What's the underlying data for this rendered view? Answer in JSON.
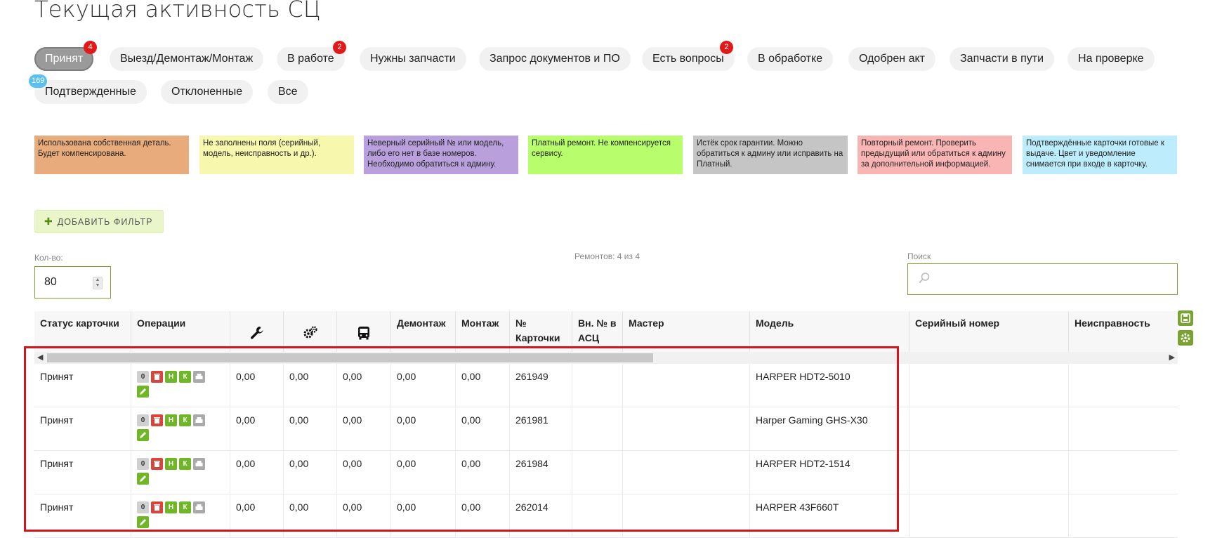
{
  "page_title": "Текущая активность СЦ",
  "tabs": [
    {
      "label": "Принят",
      "badge": "4",
      "active": true
    },
    {
      "label": "Выезд/Демонтаж/Монтаж"
    },
    {
      "label": "В работе",
      "badge": "2"
    },
    {
      "label": "Нужны запчасти"
    },
    {
      "label": "Запрос документов и ПО"
    },
    {
      "label": "Есть вопросы",
      "badge": "2"
    },
    {
      "label": "В обработке"
    },
    {
      "label": "Одобрен акт"
    },
    {
      "label": "Запчасти в пути"
    },
    {
      "label": "На проверке"
    },
    {
      "label": "Подтвержденные",
      "badge": "169"
    },
    {
      "label": "Отклоненные"
    },
    {
      "label": "Все"
    }
  ],
  "legend": [
    {
      "text": "Использована собственная деталь. Будет компенсирована.",
      "color": "#e8ac7c"
    },
    {
      "text": "Не заполнены поля (серийный, модель, неисправность и др.).",
      "color": "#f7f7ae"
    },
    {
      "text": "Неверный серийный № или модель, либо его нет в базе номеров. Необходимо обратиться к админу.",
      "color": "#b9a0dc"
    },
    {
      "text": "Платный ремонт. Не компенсируется сервису.",
      "color": "#b8fd6b"
    },
    {
      "text": "Истёк срок гарантии. Можно обратиться к админу или исправить на Платный.",
      "color": "#c5c5c5"
    },
    {
      "text": "Повторный ремонт. Проверить предыдущий или обратиться к админу за дополнительной информацией.",
      "color": "#f9b5b4"
    },
    {
      "text": "Подтверждённые карточки готовые к выдаче. Цвет и уведомление снимается при входе в карточку.",
      "color": "#bdecfd"
    }
  ],
  "add_filter_label": "ДОБАВИТЬ ФИЛЬТР",
  "qty": {
    "label": "Кол-во:",
    "value": "80"
  },
  "repairs_count": "Ремонтов: 4 из 4",
  "search": {
    "label": "Поиск",
    "placeholder": ""
  },
  "columns": [
    {
      "label": "Статус карточки"
    },
    {
      "label": "Операции"
    },
    {
      "label": "",
      "icon": "wrench-icon"
    },
    {
      "label": "",
      "icon": "gears-icon"
    },
    {
      "label": "",
      "icon": "bus-icon"
    },
    {
      "label": "Демонтаж"
    },
    {
      "label": "Монтаж"
    },
    {
      "label": "№ Карточки"
    },
    {
      "label": "Вн. № в АСЦ"
    },
    {
      "label": "Мастер"
    },
    {
      "label": "Модель"
    },
    {
      "label": "Серийный номер"
    },
    {
      "label": "Неисправность"
    }
  ],
  "ops_buttons": {
    "count": "0",
    "n": "Н",
    "k": "К"
  },
  "rows": [
    {
      "status": "Принят",
      "c1": "0,00",
      "c2": "0,00",
      "c3": "0,00",
      "dem": "0,00",
      "mon": "0,00",
      "card": "261949",
      "int": "",
      "master": "",
      "model": "HARPER HDT2-5010",
      "serial": "",
      "fault": ""
    },
    {
      "status": "Принят",
      "c1": "0,00",
      "c2": "0,00",
      "c3": "0,00",
      "dem": "0,00",
      "mon": "0,00",
      "card": "261981",
      "int": "",
      "master": "",
      "model": "Harper Gaming GHS-X30",
      "serial": "",
      "fault": ""
    },
    {
      "status": "Принят",
      "c1": "0,00",
      "c2": "0,00",
      "c3": "0,00",
      "dem": "0,00",
      "mon": "0,00",
      "card": "261984",
      "int": "",
      "master": "",
      "model": "HARPER HDT2-1514",
      "serial": "",
      "fault": ""
    },
    {
      "status": "Принят",
      "c1": "0,00",
      "c2": "0,00",
      "c3": "0,00",
      "dem": "0,00",
      "mon": "0,00",
      "card": "262014",
      "int": "",
      "master": "",
      "model": "HARPER 43F660T",
      "serial": "",
      "fault": ""
    }
  ],
  "colors": {
    "accent": "#7aa233",
    "badge_red": "#e11919",
    "badge_blue": "#5bc0f0",
    "highlight": "#d7141a"
  }
}
